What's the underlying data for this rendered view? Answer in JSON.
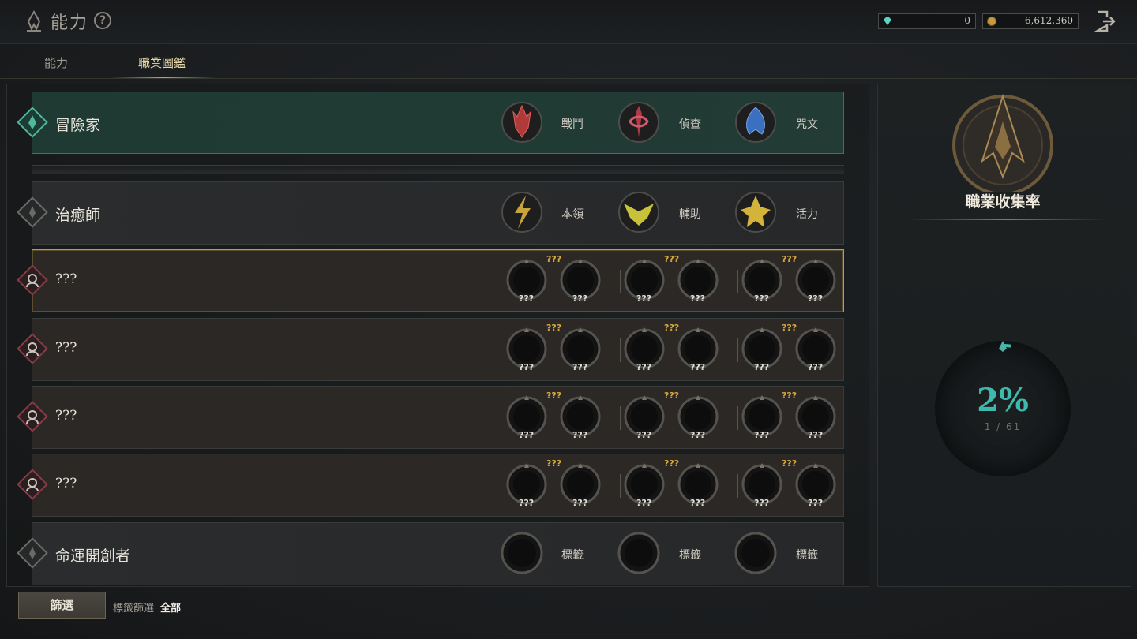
{
  "header": {
    "title": "能力",
    "help_icon": "help-circle-icon",
    "gems": "0",
    "gold": "6,612,360",
    "exit_icon": "exit-icon"
  },
  "tabs": [
    {
      "label": "能力",
      "active": false
    },
    {
      "label": "職業圖鑑",
      "active": true
    }
  ],
  "classes": [
    {
      "name": "冒險家",
      "icon": "adventurer-emblem-icon",
      "highlight": "teal",
      "subclasses": [
        {
          "label": "戰鬥",
          "icon": "combat-emblem-icon",
          "color": "#b03a3a"
        },
        {
          "label": "偵查",
          "icon": "scout-emblem-icon",
          "color": "#b03a4a"
        },
        {
          "label": "咒文",
          "icon": "spell-emblem-icon",
          "color": "#3b6fc0"
        }
      ]
    },
    {
      "name": "治癒師",
      "icon": "healer-emblem-icon",
      "subclasses": [
        {
          "label": "本領",
          "icon": "skill-emblem-icon",
          "color": "#c8a23a"
        },
        {
          "label": "輔助",
          "icon": "support-emblem-icon",
          "color": "#c8c23a"
        },
        {
          "label": "活力",
          "icon": "vitality-emblem-icon",
          "color": "#d4b33a"
        }
      ]
    },
    {
      "name": "???",
      "icon": "locked-class-icon",
      "locked": true,
      "selected": true,
      "group_label": "???",
      "slot_label": "???"
    },
    {
      "name": "???",
      "icon": "locked-class-icon",
      "locked": true,
      "group_label": "???",
      "slot_label": "???"
    },
    {
      "name": "???",
      "icon": "locked-class-icon",
      "locked": true,
      "group_label": "???",
      "slot_label": "???"
    },
    {
      "name": "???",
      "icon": "locked-class-icon",
      "locked": true,
      "group_label": "???",
      "slot_label": "???"
    },
    {
      "name": "命運開創者",
      "icon": "fate-pioneer-emblem-icon",
      "subclasses": [
        {
          "label": "標籤",
          "icon": "empty-emblem-icon"
        },
        {
          "label": "標籤",
          "icon": "empty-emblem-icon"
        },
        {
          "label": "標籤",
          "icon": "empty-emblem-icon"
        }
      ]
    }
  ],
  "filter": {
    "button_label": "篩選",
    "label": "標籤篩選",
    "value": "全部"
  },
  "collection": {
    "title": "職業收集率",
    "percent": "2%",
    "count": "1 / 61",
    "accent": "#3fb9ad"
  }
}
